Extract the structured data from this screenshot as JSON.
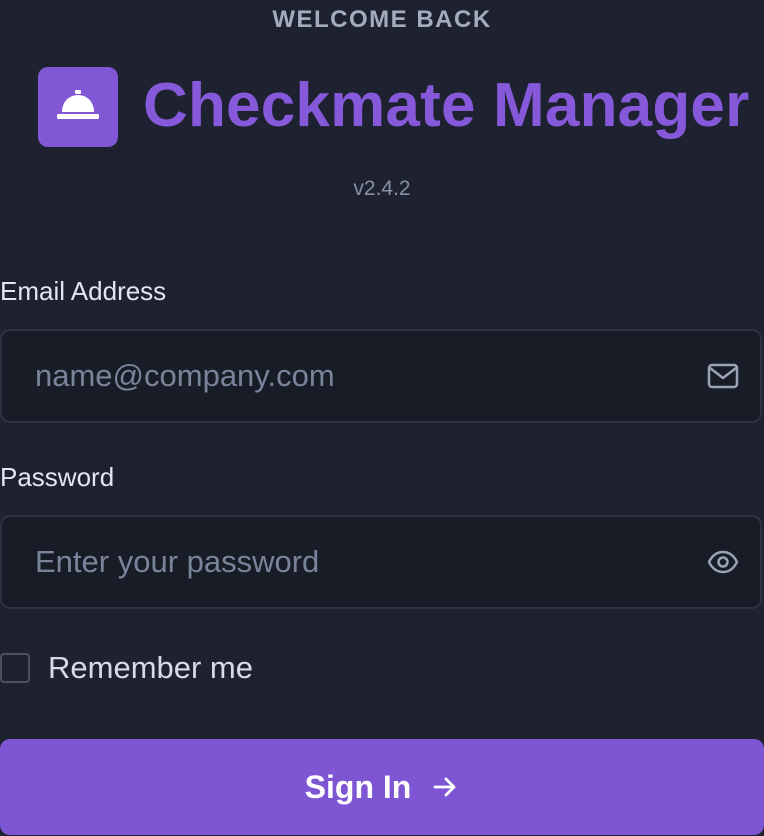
{
  "header": {
    "eyebrow": "WELCOME BACK",
    "app_name": "Checkmate Manager",
    "version": "v2.4.2",
    "logo_icon": "service-bell-icon"
  },
  "form": {
    "email": {
      "label": "Email Address",
      "placeholder": "name@company.com",
      "value": "",
      "icon": "mail-icon"
    },
    "password": {
      "label": "Password",
      "placeholder": "Enter your password",
      "value": "",
      "icon": "eye-icon"
    },
    "remember": {
      "label": "Remember me",
      "checked": false
    },
    "submit": {
      "label": "Sign In",
      "icon": "arrow-right-icon"
    }
  },
  "colors": {
    "background": "#1e2230",
    "accent": "#8257d6",
    "field_background": "#181c27",
    "muted_text": "#8690a3"
  }
}
